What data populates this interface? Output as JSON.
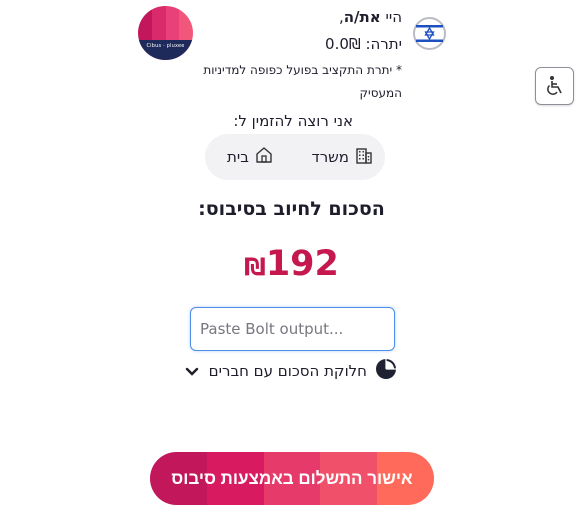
{
  "header": {
    "greeting_prefix": "היי",
    "user_name": "את/ה",
    "greeting_suffix": ",",
    "balance_label": "יתרה:",
    "balance_value": "0.0₪",
    "note": "* יתרת התקציב בפועל כפופה למדיניות המעסיק"
  },
  "logo": {
    "text": "Cibus · pluxee",
    "colors": [
      "#1e2a5a",
      "#c2185b",
      "#e91e63",
      "#f06292",
      "#ff8a65"
    ]
  },
  "flag": {
    "icon": "israel-flag-icon",
    "colors": [
      "#ffffff",
      "#1c4fbf"
    ]
  },
  "accessibility": {
    "icon": "wheelchair-icon"
  },
  "order": {
    "prompt": "אני רוצה להזמין ל:",
    "options": [
      {
        "label": "משרד",
        "icon": "building-icon"
      },
      {
        "label": "בית",
        "icon": "home-icon"
      }
    ]
  },
  "summary": {
    "title": "הסכום לחיוב בסיבוס:",
    "currency": "₪",
    "amount": "192",
    "color": "#c4184f"
  },
  "paste_input": {
    "value": "",
    "placeholder": "Paste Bolt output..."
  },
  "split": {
    "label": "חלוקת הסכום עם חברים",
    "icon": "pie-chart-icon",
    "toggle_icon": "chevron-down-icon"
  },
  "confirm": {
    "label": "אישור התשלום באמצעות סיבוס",
    "colors": [
      "#c2185b",
      "#d81b60",
      "#e91e63",
      "#f04a6a",
      "#ff6a5a"
    ]
  }
}
